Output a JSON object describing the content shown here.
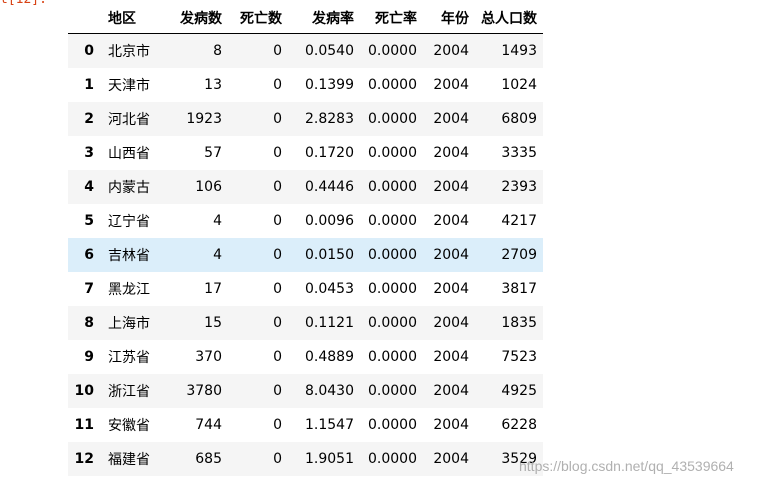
{
  "output_prompt": "t[12]:",
  "table": {
    "columns": [
      "地区",
      "发病数",
      "死亡数",
      "发病率",
      "死亡率",
      "年份",
      "总人口数"
    ],
    "rows": [
      {
        "index": "0",
        "cells": [
          "北京市",
          "8",
          "0",
          "0.0540",
          "0.0000",
          "2004",
          "1493"
        ]
      },
      {
        "index": "1",
        "cells": [
          "天津市",
          "13",
          "0",
          "0.1399",
          "0.0000",
          "2004",
          "1024"
        ]
      },
      {
        "index": "2",
        "cells": [
          "河北省",
          "1923",
          "0",
          "2.8283",
          "0.0000",
          "2004",
          "6809"
        ]
      },
      {
        "index": "3",
        "cells": [
          "山西省",
          "57",
          "0",
          "0.1720",
          "0.0000",
          "2004",
          "3335"
        ]
      },
      {
        "index": "4",
        "cells": [
          "内蒙古",
          "106",
          "0",
          "0.4446",
          "0.0000",
          "2004",
          "2393"
        ]
      },
      {
        "index": "5",
        "cells": [
          "辽宁省",
          "4",
          "0",
          "0.0096",
          "0.0000",
          "2004",
          "4217"
        ]
      },
      {
        "index": "6",
        "cells": [
          "吉林省",
          "4",
          "0",
          "0.0150",
          "0.0000",
          "2004",
          "2709"
        ]
      },
      {
        "index": "7",
        "cells": [
          "黑龙江",
          "17",
          "0",
          "0.0453",
          "0.0000",
          "2004",
          "3817"
        ]
      },
      {
        "index": "8",
        "cells": [
          "上海市",
          "15",
          "0",
          "0.1121",
          "0.0000",
          "2004",
          "1835"
        ]
      },
      {
        "index": "9",
        "cells": [
          "江苏省",
          "370",
          "0",
          "0.4889",
          "0.0000",
          "2004",
          "7523"
        ]
      },
      {
        "index": "10",
        "cells": [
          "浙江省",
          "3780",
          "0",
          "8.0430",
          "0.0000",
          "2004",
          "4925"
        ]
      },
      {
        "index": "11",
        "cells": [
          "安徽省",
          "744",
          "0",
          "1.1547",
          "0.0000",
          "2004",
          "6228"
        ]
      },
      {
        "index": "12",
        "cells": [
          "福建省",
          "685",
          "0",
          "1.9051",
          "0.0000",
          "2004",
          "3529"
        ]
      }
    ],
    "hovered_row_index": 6
  },
  "watermark": "https://blog.csdn.net/qq_43539664",
  "colors": {
    "prompt": "#d84315",
    "row_stripe": "#f5f5f5",
    "row_hover": "#dbeefa"
  }
}
